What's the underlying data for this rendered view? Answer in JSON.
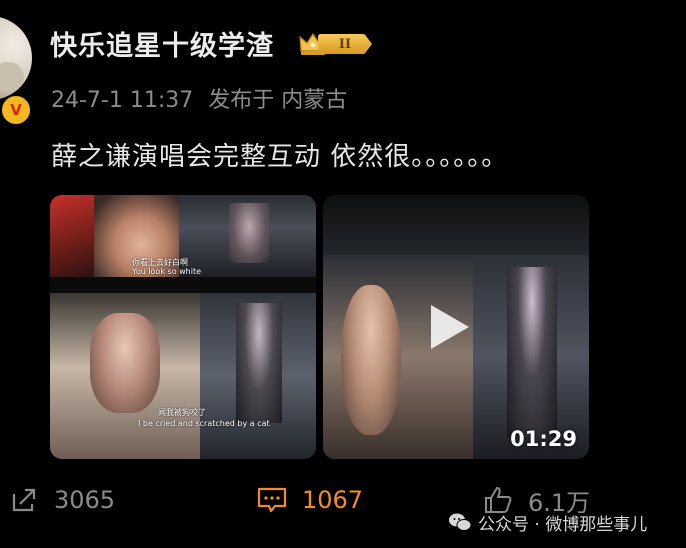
{
  "header": {
    "username": "快乐追星十级学渣",
    "level_badge": "II",
    "verified_badge": "V"
  },
  "meta": {
    "date": "24-7-1 11:37",
    "published_in": "发布于 内蒙古"
  },
  "post": {
    "text": "薛之谦演唱会完整互动 依然很。。。。。。"
  },
  "media": {
    "image_1": {
      "subtitle_1a": "你看上去好白啊",
      "subtitle_1b": "You look so white",
      "subtitle_2a": "闻我被狗咬了",
      "subtitle_2b": "I be cried and scratched by a cat"
    },
    "video": {
      "duration": "01:29"
    }
  },
  "actions": {
    "share_count": "3065",
    "comment_count": "1067",
    "like_count": "6.1万"
  },
  "watermark": {
    "text": "公众号 · 微博那些事儿"
  },
  "colors": {
    "background": "#000000",
    "comment_accent": "#f28c28",
    "muted": "#8a8a8a"
  }
}
